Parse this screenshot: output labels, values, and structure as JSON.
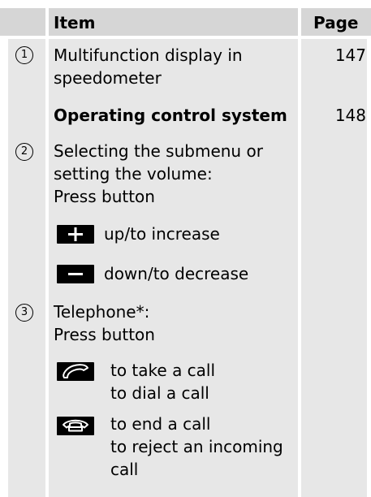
{
  "header": {
    "item": "Item",
    "page": "Page"
  },
  "rows": [
    {
      "num": "1",
      "lines": [
        "Multifunction display in",
        "speedometer"
      ],
      "page": "147"
    },
    {
      "lines": [
        "Operating control system"
      ],
      "page": "148"
    },
    {
      "num": "2",
      "lines": [
        "Selecting the submenu or",
        "setting the volume:",
        "Press button"
      ]
    },
    {
      "icon": "plus-button-icon",
      "lines": [
        "up/to increase"
      ]
    },
    {
      "icon": "minus-button-icon",
      "lines": [
        "down/to decrease"
      ]
    },
    {
      "num": "3",
      "lines": [
        "Telephone*:",
        "Press button"
      ]
    },
    {
      "icon": "phone-pickup-icon",
      "lines": [
        "to take a call",
        "to dial a call"
      ]
    },
    {
      "icon": "phone-hangup-icon",
      "lines": [
        "to end a call",
        "to reject an incoming",
        "call"
      ]
    }
  ]
}
